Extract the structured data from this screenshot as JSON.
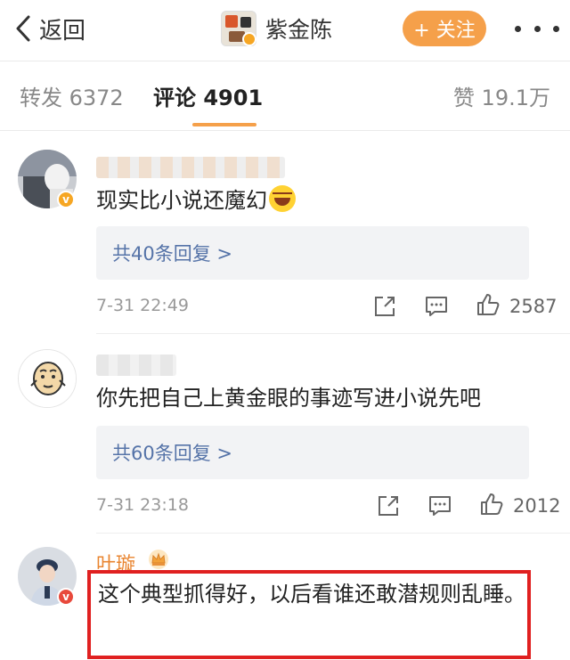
{
  "navbar": {
    "back_label": "返回",
    "title": "紫金陈",
    "follow_label": "+ 关注",
    "accent_color": "#f5a04a"
  },
  "tabs": {
    "repost": "转发 6372",
    "comment": "评论 4901",
    "like": "赞 19.1万"
  },
  "comments": [
    {
      "text": "现实比小说还魔幻",
      "reply_label": "共40条回复 >",
      "time": "7-31 22:49",
      "likes": "2587"
    },
    {
      "text": "你先把自己上黄金眼的事迹写进小说先吧",
      "reply_label": "共60条回复 >",
      "time": "7-31 23:18",
      "likes": "2012"
    },
    {
      "username": "叶璇",
      "text": "这个典型抓得好，以后看谁还敢潜规则乱睡。"
    }
  ],
  "icons": {
    "back": "chevron-left-icon",
    "more": "more-dots-icon",
    "share": "share-icon",
    "comment": "comment-icon",
    "like": "thumbs-up-icon",
    "crown": "crown-icon",
    "verified": "verified-badge-icon",
    "emoji": "laugh-cry-emoji"
  }
}
